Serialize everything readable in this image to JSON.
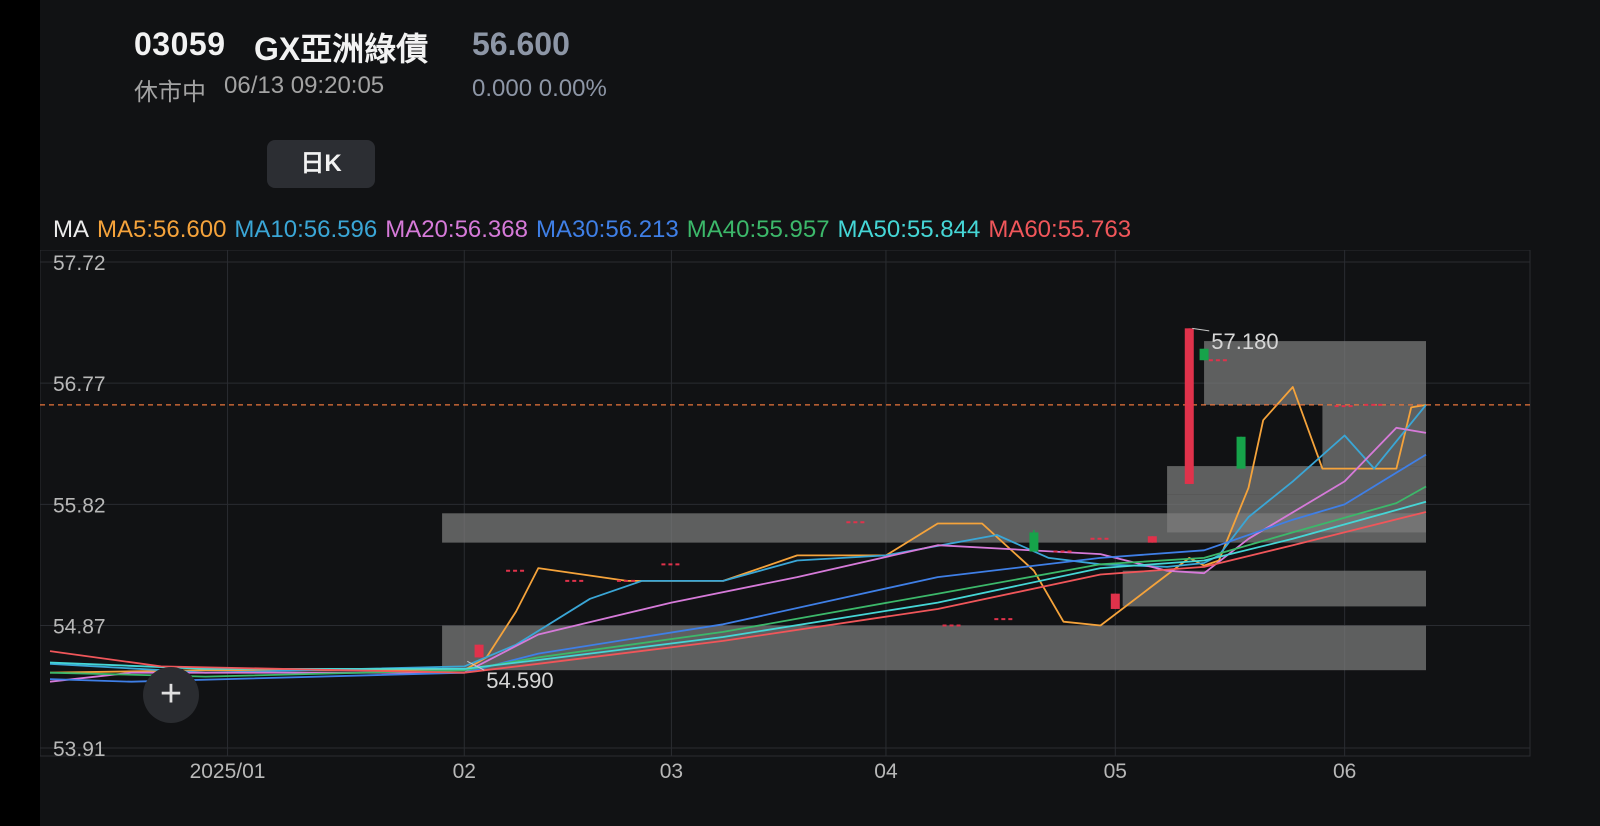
{
  "header": {
    "code": "03059",
    "name": "GX亞洲綠債",
    "price": "56.600",
    "status": "休市中",
    "timestamp": "06/13 09:20:05",
    "change": "0.000 0.00%"
  },
  "toolbar": {
    "period_label": "日K"
  },
  "add_icon": "plus-icon",
  "colors": {
    "background": "#111214",
    "up": "#e0324b",
    "down": "#16a34a",
    "grid": "#2a2c31",
    "axis_text": "#b8b8b8",
    "price_line": "#e8743b"
  },
  "ma_legend": {
    "prefix": "MA",
    "items": [
      {
        "label": "MA5:56.600",
        "color": "#f5a33b"
      },
      {
        "label": "MA10:56.596",
        "color": "#3aa6d6"
      },
      {
        "label": "MA20:56.368",
        "color": "#d67ad9"
      },
      {
        "label": "MA30:56.213",
        "color": "#3f7fe6"
      },
      {
        "label": "MA40:55.957",
        "color": "#3cb86a"
      },
      {
        "label": "MA50:55.844",
        "color": "#45d6d6"
      },
      {
        "label": "MA60:55.763",
        "color": "#f0565a"
      }
    ]
  },
  "chart_data": {
    "type": "candlestick",
    "y_axis": {
      "ticks": [
        "57.72",
        "56.77",
        "55.82",
        "54.87",
        "53.91"
      ],
      "min": 53.91,
      "max": 57.72
    },
    "x_axis": {
      "ticks": [
        "2025/01",
        "02",
        "03",
        "04",
        "05",
        "06"
      ]
    },
    "x_tick_dates": [
      "2025-01-02",
      "2025-02-03",
      "2025-03-03",
      "2025-04-01",
      "2025-05-02",
      "2025-06-02"
    ],
    "x_range": [
      "2024-12-09",
      "2025-06-13"
    ],
    "current_price": 56.6,
    "annotations": [
      {
        "text": "57.180",
        "date": "2025-05-12",
        "value": 57.18,
        "anchor_value": 57.2
      },
      {
        "text": "54.590",
        "date": "2025-02-03",
        "value": 54.52,
        "anchor_value": 54.59
      }
    ],
    "candles": [
      {
        "date": "2025-02-05",
        "open": 54.62,
        "close": 54.72,
        "high": 54.72,
        "low": 54.62
      },
      {
        "date": "2025-02-10",
        "open": 55.3,
        "close": 55.3,
        "high": 55.3,
        "low": 55.3
      },
      {
        "date": "2025-02-18",
        "open": 55.22,
        "close": 55.22,
        "high": 55.22,
        "low": 55.22
      },
      {
        "date": "2025-02-25",
        "open": 55.22,
        "close": 55.22,
        "high": 55.22,
        "low": 55.22
      },
      {
        "date": "2025-03-03",
        "open": 55.35,
        "close": 55.35,
        "high": 55.35,
        "low": 55.35
      },
      {
        "date": "2025-03-28",
        "open": 55.68,
        "close": 55.68,
        "high": 55.68,
        "low": 55.68
      },
      {
        "date": "2025-04-10",
        "open": 54.87,
        "close": 54.87,
        "high": 54.87,
        "low": 54.87
      },
      {
        "date": "2025-04-17",
        "open": 54.92,
        "close": 54.92,
        "high": 54.92,
        "low": 54.92
      },
      {
        "date": "2025-04-21",
        "open": 55.6,
        "close": 55.45,
        "high": 55.62,
        "low": 55.45
      },
      {
        "date": "2025-04-25",
        "open": 55.45,
        "close": 55.45,
        "high": 55.45,
        "low": 55.45
      },
      {
        "date": "2025-04-30",
        "open": 55.55,
        "close": 55.55,
        "high": 55.55,
        "low": 55.55
      },
      {
        "date": "2025-05-02",
        "open": 55.0,
        "close": 55.12,
        "high": 55.12,
        "low": 55.0
      },
      {
        "date": "2025-05-07",
        "open": 55.52,
        "close": 55.57,
        "high": 55.57,
        "low": 55.52
      },
      {
        "date": "2025-05-12",
        "open": 55.98,
        "close": 57.2,
        "high": 57.2,
        "low": 55.98
      },
      {
        "date": "2025-05-14",
        "open": 57.04,
        "close": 56.95,
        "high": 57.04,
        "low": 56.95
      },
      {
        "date": "2025-05-16",
        "open": 56.95,
        "close": 56.95,
        "high": 56.95,
        "low": 56.95
      },
      {
        "date": "2025-05-19",
        "open": 56.35,
        "close": 56.1,
        "high": 56.35,
        "low": 56.1
      },
      {
        "date": "2025-06-02",
        "open": 56.59,
        "close": 56.59,
        "high": 56.59,
        "low": 56.59
      },
      {
        "date": "2025-06-06",
        "open": 56.6,
        "close": 56.6,
        "high": 56.6,
        "low": 56.6
      }
    ],
    "volume_profile": [
      {
        "low": 55.52,
        "high": 55.75,
        "start": "2025-01-31",
        "end": "2025-06-13"
      },
      {
        "low": 54.52,
        "high": 54.87,
        "start": "2025-01-31",
        "end": "2025-06-13"
      },
      {
        "low": 55.02,
        "high": 55.3,
        "start": "2025-05-03",
        "end": "2025-06-13"
      },
      {
        "low": 55.6,
        "high": 55.9,
        "start": "2025-05-09",
        "end": "2025-06-13"
      },
      {
        "low": 55.9,
        "high": 56.12,
        "start": "2025-05-09",
        "end": "2025-06-13"
      },
      {
        "low": 56.12,
        "high": 56.6,
        "start": "2025-05-30",
        "end": "2025-06-13"
      },
      {
        "low": 56.6,
        "high": 57.1,
        "start": "2025-05-14",
        "end": "2025-06-13"
      }
    ],
    "series": [
      {
        "name": "MA5",
        "color": "#f5a33b",
        "points": [
          [
            "2024-12-09",
            54.5
          ],
          [
            "2024-12-30",
            54.52
          ],
          [
            "2025-02-03",
            54.52
          ],
          [
            "2025-02-06",
            54.62
          ],
          [
            "2025-02-10",
            54.98
          ],
          [
            "2025-02-13",
            55.32
          ],
          [
            "2025-02-25",
            55.22
          ],
          [
            "2025-03-10",
            55.22
          ],
          [
            "2025-03-20",
            55.42
          ],
          [
            "2025-04-01",
            55.42
          ],
          [
            "2025-04-08",
            55.67
          ],
          [
            "2025-04-14",
            55.67
          ],
          [
            "2025-04-21",
            55.3
          ],
          [
            "2025-04-25",
            54.9
          ],
          [
            "2025-04-30",
            54.87
          ],
          [
            "2025-05-07",
            55.18
          ],
          [
            "2025-05-12",
            55.4
          ],
          [
            "2025-05-14",
            55.34
          ],
          [
            "2025-05-16",
            55.38
          ],
          [
            "2025-05-20",
            55.95
          ],
          [
            "2025-05-22",
            56.48
          ],
          [
            "2025-05-26",
            56.74
          ],
          [
            "2025-05-30",
            56.1
          ],
          [
            "2025-06-09",
            56.1
          ],
          [
            "2025-06-11",
            56.58
          ],
          [
            "2025-06-13",
            56.6
          ]
        ]
      },
      {
        "name": "MA10",
        "color": "#3aa6d6",
        "points": [
          [
            "2024-12-09",
            54.57
          ],
          [
            "2024-12-30",
            54.5
          ],
          [
            "2025-02-03",
            54.55
          ],
          [
            "2025-02-10",
            54.72
          ],
          [
            "2025-02-20",
            55.08
          ],
          [
            "2025-02-27",
            55.22
          ],
          [
            "2025-03-10",
            55.22
          ],
          [
            "2025-03-20",
            55.38
          ],
          [
            "2025-04-01",
            55.42
          ],
          [
            "2025-04-16",
            55.58
          ],
          [
            "2025-04-23",
            55.4
          ],
          [
            "2025-04-30",
            55.35
          ],
          [
            "2025-05-09",
            55.33
          ],
          [
            "2025-05-14",
            55.36
          ],
          [
            "2025-05-16",
            55.42
          ],
          [
            "2025-05-20",
            55.72
          ],
          [
            "2025-05-26",
            56.0
          ],
          [
            "2025-06-02",
            56.36
          ],
          [
            "2025-06-06",
            56.1
          ],
          [
            "2025-06-13",
            56.6
          ]
        ]
      },
      {
        "name": "MA20",
        "color": "#d67ad9",
        "points": [
          [
            "2024-12-09",
            54.43
          ],
          [
            "2024-12-20",
            54.5
          ],
          [
            "2025-02-03",
            54.5
          ],
          [
            "2025-02-13",
            54.8
          ],
          [
            "2025-03-03",
            55.05
          ],
          [
            "2025-03-20",
            55.25
          ],
          [
            "2025-04-08",
            55.5
          ],
          [
            "2025-04-30",
            55.43
          ],
          [
            "2025-05-09",
            55.3
          ],
          [
            "2025-05-14",
            55.28
          ],
          [
            "2025-05-20",
            55.55
          ],
          [
            "2025-06-02",
            56.0
          ],
          [
            "2025-06-09",
            56.42
          ],
          [
            "2025-06-13",
            56.38
          ]
        ]
      },
      {
        "name": "MA30",
        "color": "#3f7fe6",
        "points": [
          [
            "2024-12-09",
            54.45
          ],
          [
            "2024-12-20",
            54.43
          ],
          [
            "2025-02-03",
            54.5
          ],
          [
            "2025-02-13",
            54.65
          ],
          [
            "2025-03-10",
            54.88
          ],
          [
            "2025-04-08",
            55.25
          ],
          [
            "2025-04-30",
            55.4
          ],
          [
            "2025-05-14",
            55.46
          ],
          [
            "2025-05-26",
            55.7
          ],
          [
            "2025-06-02",
            55.82
          ],
          [
            "2025-06-13",
            56.21
          ]
        ]
      },
      {
        "name": "MA40",
        "color": "#3cb86a",
        "points": [
          [
            "2024-12-09",
            54.5
          ],
          [
            "2024-12-30",
            54.47
          ],
          [
            "2025-02-03",
            54.52
          ],
          [
            "2025-02-13",
            54.62
          ],
          [
            "2025-03-10",
            54.82
          ],
          [
            "2025-04-08",
            55.12
          ],
          [
            "2025-04-30",
            55.35
          ],
          [
            "2025-05-14",
            55.4
          ],
          [
            "2025-05-26",
            55.6
          ],
          [
            "2025-06-09",
            55.83
          ],
          [
            "2025-06-13",
            55.96
          ]
        ]
      },
      {
        "name": "MA50",
        "color": "#45d6d6",
        "points": [
          [
            "2024-12-09",
            54.58
          ],
          [
            "2024-12-30",
            54.53
          ],
          [
            "2025-02-03",
            54.53
          ],
          [
            "2025-02-13",
            54.6
          ],
          [
            "2025-03-10",
            54.78
          ],
          [
            "2025-04-08",
            55.05
          ],
          [
            "2025-04-30",
            55.32
          ],
          [
            "2025-05-14",
            55.38
          ],
          [
            "2025-05-26",
            55.55
          ],
          [
            "2025-06-13",
            55.84
          ]
        ]
      },
      {
        "name": "MA60",
        "color": "#f0565a",
        "points": [
          [
            "2024-12-09",
            54.67
          ],
          [
            "2024-12-24",
            54.55
          ],
          [
            "2025-02-03",
            54.5
          ],
          [
            "2025-02-13",
            54.57
          ],
          [
            "2025-03-10",
            54.75
          ],
          [
            "2025-04-08",
            55.0
          ],
          [
            "2025-04-30",
            55.27
          ],
          [
            "2025-05-14",
            55.33
          ],
          [
            "2025-05-26",
            55.5
          ],
          [
            "2025-06-13",
            55.76
          ]
        ]
      }
    ]
  }
}
